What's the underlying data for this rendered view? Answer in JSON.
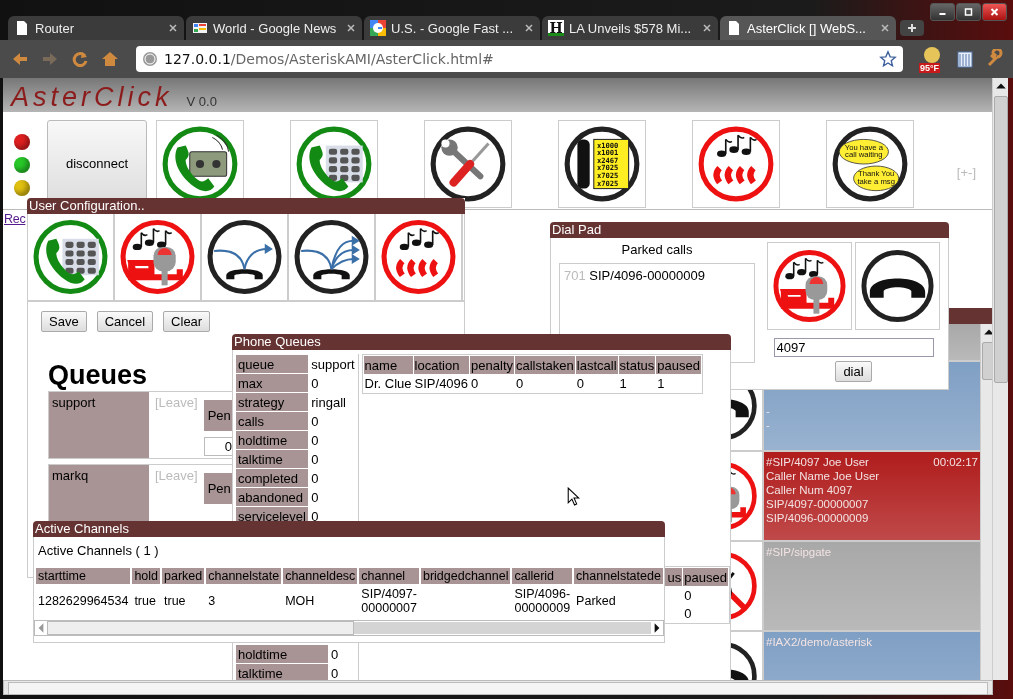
{
  "browser": {
    "tabs": [
      {
        "title": "Router",
        "kind": "page",
        "selected": false
      },
      {
        "title": "World - Google News",
        "kind": "news",
        "selected": false
      },
      {
        "title": "U.S. - Google Fast ...",
        "kind": "google",
        "selected": false
      },
      {
        "title": "LA Unveils $578 Mi...",
        "kind": "letter",
        "icon_text": "H",
        "selected": false
      },
      {
        "title": "AsterClick [] WebS...",
        "kind": "page",
        "selected": true
      }
    ],
    "url_host": "127.0.0.1",
    "url_path": "/Demos/AsteriskAMI/AsterClick.html#",
    "weather": "95°F"
  },
  "app": {
    "title": "AsterClick",
    "version": "V 0.0",
    "lights": [
      {
        "color": "#e02020"
      },
      {
        "color": "#28c828"
      },
      {
        "color": "#e0c010"
      }
    ],
    "disconnect": "disconnect",
    "tools": [
      {
        "kind": "phone-tape"
      },
      {
        "kind": "phone-keypad"
      },
      {
        "kind": "tools"
      },
      {
        "kind": "directory",
        "lines": [
          "x1000",
          "x1001",
          "x2467",
          "x7025",
          "x7025",
          "x7025"
        ]
      },
      {
        "kind": "conference"
      },
      {
        "kind": "chat",
        "lines": [
          "You have a",
          "call waiting",
          "Thank You",
          "take a msg"
        ]
      }
    ],
    "toggle": "[+-]",
    "link": "Rec"
  },
  "user_config": {
    "title": "User Configuration..",
    "tools": [
      {
        "kind": "phone-keypad"
      },
      {
        "kind": "park"
      },
      {
        "kind": "transfer"
      },
      {
        "kind": "transfer-multi"
      },
      {
        "kind": "conference"
      }
    ],
    "buttons": [
      "Save",
      "Cancel",
      "Clear"
    ],
    "heading": "Queues",
    "queues": [
      {
        "name": "support",
        "action": "[Leave]",
        "column_3": "Pen",
        "value": "0"
      },
      {
        "name": "markq",
        "action": "[Leave]",
        "column_3": "Pen"
      }
    ]
  },
  "phone_queues": {
    "title": "Phone Queues",
    "queues": [
      {
        "fields": [
          [
            "queue",
            "support"
          ],
          [
            "max",
            "0"
          ],
          [
            "strategy",
            "ringall"
          ],
          [
            "calls",
            "0"
          ],
          [
            "holdtime",
            "0"
          ],
          [
            "talktime",
            "0"
          ],
          [
            "completed",
            "0"
          ],
          [
            "abandoned",
            "0"
          ],
          [
            "servicelevel",
            "0"
          ]
        ],
        "members": {
          "columns": [
            "name",
            "location",
            "penalty",
            "callstaken",
            "lastcall",
            "status",
            "paused"
          ],
          "rows": [
            [
              "Dr. Clue",
              "SIP/4096",
              "0",
              "0",
              "0",
              "1",
              "1"
            ]
          ]
        }
      },
      {
        "fields": [
          [
            "holdtime",
            "0"
          ],
          [
            "talktime",
            "0"
          ]
        ],
        "members": {
          "columns": [
            "us",
            "paused"
          ],
          "rows": [
            [
              null,
              "0"
            ],
            [
              null,
              "0"
            ]
          ]
        }
      }
    ]
  },
  "dial_pad": {
    "title": "Dial Pad",
    "parked_heading": "Parked calls",
    "parked": [
      {
        "slot": "701",
        "channel": "SIP/4096-00000009"
      }
    ],
    "tools": [
      {
        "kind": "park"
      },
      {
        "kind": "hangup"
      }
    ],
    "number": "4097",
    "button": "dial"
  },
  "channels": {
    "rows": [
      {
        "color": "#a8a8a8"
      },
      {
        "color": "#7f9fc4",
        "lines": [
          "-",
          "-"
        ]
      },
      {
        "color": "#b01c1c",
        "lines": [
          "#SIP/4097 Joe User",
          "Caller Name Joe User",
          "Caller Num 4097",
          "SIP/4097-00000007",
          "SIP/4096-00000009"
        ],
        "time": "00:02:17"
      },
      {
        "color": "#a8a8a8",
        "lines": [
          "#SIP/sipgate"
        ]
      },
      {
        "color": "#7f9fc4",
        "lines": [
          "#IAX2/demo/asterisk"
        ]
      }
    ]
  },
  "active_channels": {
    "title": "Active Channels",
    "summary": "Active Channels ( 1 )",
    "columns": [
      "starttime",
      "hold",
      "parked",
      "channelstate",
      "channeldesc",
      "channel",
      "bridgedchannel",
      "callerid",
      "channelstatede"
    ],
    "rows": [
      [
        "1282629964534",
        "true",
        "true",
        "3",
        "MOH",
        "SIP/4097-00000007",
        null,
        "SIP/4096-00000009",
        "Parked"
      ]
    ]
  }
}
